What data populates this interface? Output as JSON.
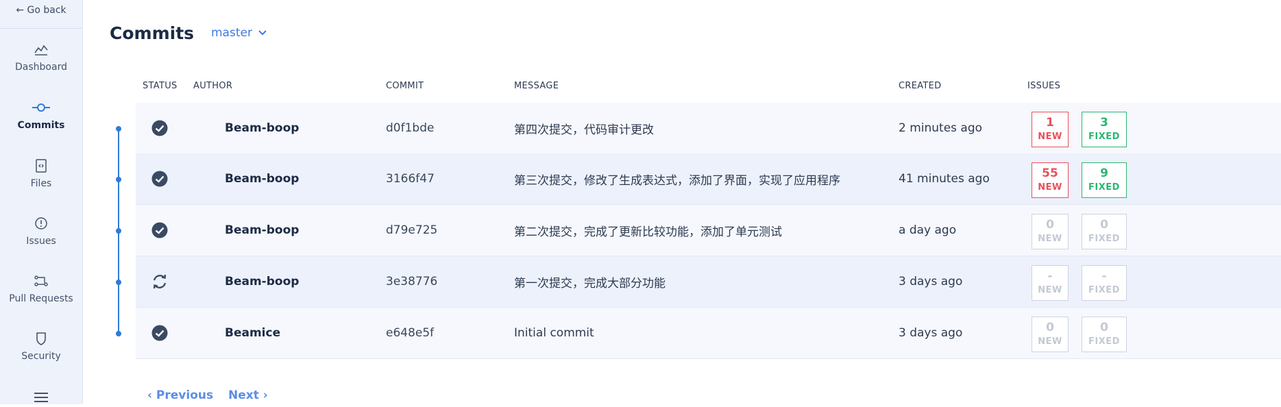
{
  "nav": {
    "go_back": "← Go back",
    "items": [
      {
        "label": "Dashboard",
        "icon": "chart-line-icon",
        "active": false
      },
      {
        "label": "Commits",
        "icon": "commit-icon",
        "active": true
      },
      {
        "label": "Files",
        "icon": "file-code-icon",
        "active": false
      },
      {
        "label": "Issues",
        "icon": "alert-circle-icon",
        "active": false
      },
      {
        "label": "Pull Requests",
        "icon": "pull-request-icon",
        "active": false
      },
      {
        "label": "Security",
        "icon": "shield-icon",
        "active": false
      }
    ]
  },
  "page": {
    "title": "Commits",
    "branch": "master"
  },
  "table": {
    "headers": {
      "status": "STATUS",
      "author": "AUTHOR",
      "commit": "COMMIT",
      "message": "MESSAGE",
      "created": "CREATED",
      "issues": "ISSUES"
    },
    "rows": [
      {
        "status": "done",
        "author": "Beam-boop",
        "commit": "d0f1bde",
        "message": "第四次提交，代码审计更改",
        "created": "2 minutes ago",
        "new": "1",
        "fixed": "3",
        "new_label": "NEW",
        "fixed_label": "FIXED",
        "state": "active"
      },
      {
        "status": "done",
        "author": "Beam-boop",
        "commit": "3166f47",
        "message": "第三次提交，修改了生成表达式，添加了界面，实现了应用程序",
        "created": "41 minutes ago",
        "new": "55",
        "fixed": "9",
        "new_label": "NEW",
        "fixed_label": "FIXED",
        "state": "active"
      },
      {
        "status": "done",
        "author": "Beam-boop",
        "commit": "d79e725",
        "message": "第二次提交，完成了更新比较功能，添加了单元测试",
        "created": "a day ago",
        "new": "0",
        "fixed": "0",
        "new_label": "NEW",
        "fixed_label": "FIXED",
        "state": "muted"
      },
      {
        "status": "syncing",
        "author": "Beam-boop",
        "commit": "3e38776",
        "message": "第一次提交，完成大部分功能",
        "created": "3 days ago",
        "new": "-",
        "fixed": "-",
        "new_label": "NEW",
        "fixed_label": "FIXED",
        "state": "muted"
      },
      {
        "status": "done",
        "author": "Beamice",
        "commit": "e648e5f",
        "message": "Initial commit",
        "created": "3 days ago",
        "new": "0",
        "fixed": "0",
        "new_label": "NEW",
        "fixed_label": "FIXED",
        "state": "muted"
      }
    ]
  },
  "pagination": {
    "previous": "‹ Previous",
    "next": "Next ›"
  },
  "colors": {
    "accent": "#3f78e0",
    "new": "#e8505b",
    "fixed": "#2bb673",
    "muted": "#cdd3de"
  }
}
